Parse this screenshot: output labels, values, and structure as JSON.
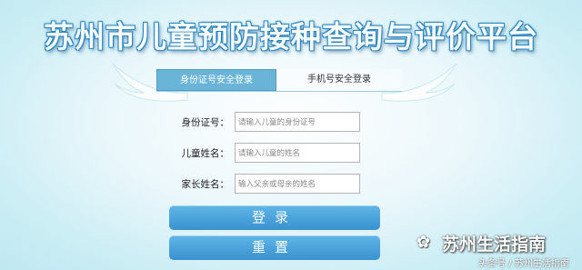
{
  "header": {
    "title": "苏州市儿童预防接种查询与评价平台"
  },
  "tabs": [
    {
      "label": "身份证号安全登录",
      "active": true
    },
    {
      "label": "手机号安全登录",
      "active": false
    }
  ],
  "form": {
    "id_label": "身份证号：",
    "id_placeholder": "请输入儿童的身份证号",
    "name_label": "儿童姓名：",
    "name_placeholder": "请输入儿童的姓名",
    "parent_label": "家长姓名：",
    "parent_placeholder": "输入父亲或母亲的姓名"
  },
  "buttons": {
    "login": "登录",
    "reset": "重置"
  },
  "watermark": {
    "name": "苏州生活指南",
    "sub": "头条号 / 苏州生活指南"
  },
  "colors": {
    "accent": "#3a92cf",
    "tab_active": "#6ab4d8"
  }
}
